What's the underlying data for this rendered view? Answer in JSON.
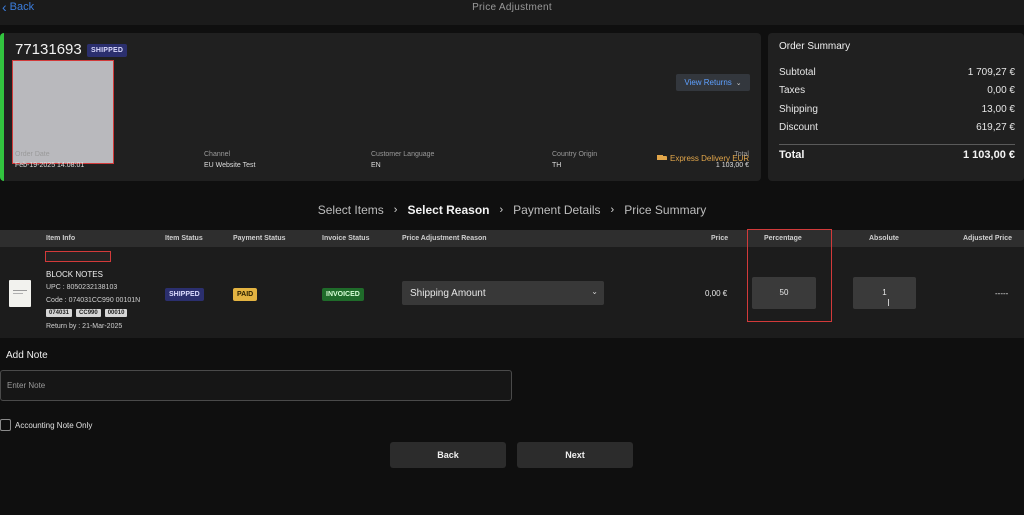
{
  "header": {
    "back_label": "Back",
    "title": "Price Adjustment"
  },
  "order": {
    "id": "77131693",
    "status": "SHIPPED",
    "view_returns_label": "View Returns",
    "delivery_method": "Express Delivery EUR",
    "info": [
      {
        "label": "Order Date",
        "value": "Feb-19-2025 14:08:01"
      },
      {
        "label": "Channel",
        "value": "EU Website Test"
      },
      {
        "label": "Customer Language",
        "value": "EN"
      },
      {
        "label": "Country Origin",
        "value": "TH"
      },
      {
        "label": "Total",
        "value": "1 103,00 €"
      }
    ],
    "accent_color": "#32c43f"
  },
  "summary": {
    "title": "Order Summary",
    "rows": [
      {
        "label": "Subtotal",
        "value": "1 709,27 €"
      },
      {
        "label": "Taxes",
        "value": "0,00 €"
      },
      {
        "label": "Shipping",
        "value": "13,00 €"
      },
      {
        "label": "Discount",
        "value": "619,27 €"
      }
    ],
    "total_label": "Total",
    "total_value": "1 103,00 €"
  },
  "stepper": {
    "steps": [
      "Select Items",
      "Select Reason",
      "Payment Details",
      "Price Summary"
    ],
    "active_index": 1
  },
  "table": {
    "headers": [
      "Item Info",
      "Item Status",
      "Payment Status",
      "Invoice Status",
      "Price Adjustment Reason",
      "Price",
      "Percentage",
      "Absolute",
      "Adjusted Price"
    ],
    "row": {
      "name": "BLOCK NOTES",
      "upc": "UPC : 8050232138103",
      "code": "Code : 074031CC990 00101N",
      "chips": [
        "074031",
        "CC990",
        "00010"
      ],
      "return_by": "Return by : 21-Mar-2025",
      "item_status": "SHIPPED",
      "payment_status": "PAID",
      "invoice_status": "INVOICED",
      "reason": "Shipping Amount",
      "price": "0,00 €",
      "percentage": "50",
      "absolute": "1",
      "adjusted_price": "-----"
    }
  },
  "note": {
    "title": "Add Note",
    "placeholder": "Enter Note",
    "accounting_label": "Accounting Note Only"
  },
  "actions": {
    "back_label": "Back",
    "next_label": "Next"
  },
  "colors": {
    "link": "#3b7ddd",
    "highlight_border": "#d23a3a",
    "paid_badge": "#e3b341",
    "invoiced_badge": "#1f6b2a",
    "shipped_badge": "#2b2f6e"
  }
}
